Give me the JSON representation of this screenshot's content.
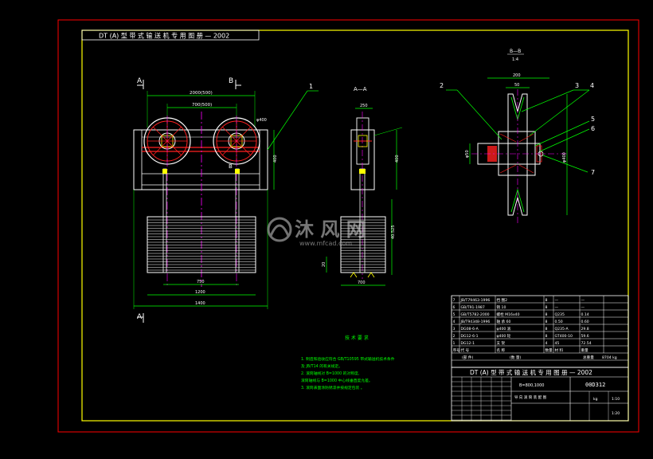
{
  "title_banner": "DT (A) 型 带 式 输 送 机 专 用 图 册  — 2002",
  "views": {
    "section_aa": "A—A",
    "section_bb": "B—B",
    "section_bb_scale": "1:4",
    "marker_a": "A",
    "marker_b": "B"
  },
  "callouts": [
    "1",
    "2",
    "3",
    "4",
    "5",
    "6",
    "7"
  ],
  "dimensions": {
    "main_top_1": "2000(500)",
    "main_top_2": "700(500)",
    "main_bottom_1": "750",
    "main_bottom_2": "1200",
    "main_bottom_3": "1400",
    "main_right": "400",
    "main_dia": "φ400",
    "side_top": "250",
    "side_height": "400",
    "side_right": "40.525",
    "side_bottom": "700",
    "side_left": "20",
    "detail_top_1": "200",
    "detail_top_2": "50",
    "detail_left": "φ50",
    "detail_right": "φ400"
  },
  "notes_title": "技 术 要 求",
  "notes": [
    "1. 制造和验收应符合 GB/T10595 带式输送机技术条件",
    "   及 JB/T14 的有关规定。",
    "2. 滚筒轴线对 B=1000 的对称度,",
    "   滚筒轴线与 B=1000 中心线垂直度允差。",
    "3. 滚筒表面涂防锈漆并按规定包装 。"
  ],
  "parts_list": {
    "rows": [
      [
        "7",
        "JB/T79463-1996",
        "挡 圈2",
        "8",
        "—",
        "—"
      ],
      [
        "6",
        "GB/T91-1987",
        "销 10",
        "8",
        "—",
        "—"
      ],
      [
        "5",
        "GB/T5782-2000",
        "螺栓 M16x40",
        "8",
        "Q235",
        "0.14"
      ],
      [
        "4",
        "JB/T94348-1996",
        "轴 承 60",
        "8",
        "0.50",
        "0.60"
      ],
      [
        "3",
        "DG08-6-A",
        "φ400 滚",
        "8",
        "Q235-A",
        "29.8"
      ],
      [
        "2",
        "DG12-6-1",
        "φ400 轮",
        "8",
        "GT400-10",
        "59.6"
      ],
      [
        "1",
        "DG12-1",
        "支 架",
        "4",
        "45",
        "72.54"
      ]
    ],
    "header": [
      "序号",
      "代 号",
      "名 称",
      "数量",
      "材 料",
      "重量"
    ],
    "footer": [
      "(部 件)",
      "(数 量)",
      "总重量",
      "8704 kg"
    ]
  },
  "title_block": {
    "banner": "DT (A) 型 带 式 输 送 机 专 用 图 册  — 2002",
    "drawing_no": "B=800,1000",
    "code": "00D312",
    "name": "导 向 滚 筒 装 配 图",
    "scale": "1:10",
    "unit": "kg",
    "sheet": "1:20"
  },
  "watermark": {
    "brand": "沐 风 网",
    "url": "www.mfcad.com"
  },
  "colors": {
    "background": "#000000",
    "outer_border": "#ff0000",
    "inner_border": "#ffff00",
    "geometry": "#ffffff",
    "dimension": "#00ff00",
    "center_line": "#ff00ff",
    "red": "#ff2020",
    "cyan": "#00ffff",
    "notes": "#00ff00"
  }
}
